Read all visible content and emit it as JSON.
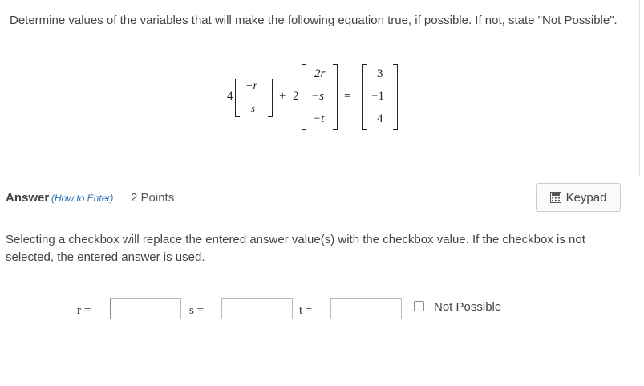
{
  "question": {
    "prompt": "Determine values of the variables that will make the following equation true, if possible. If not, state \"Not Possible\".",
    "equation": {
      "coef1": "4",
      "m1": [
        "−r",
        "s"
      ],
      "plus": "+",
      "coef2": "2",
      "m2": [
        "2r",
        "−s",
        "−t"
      ],
      "equals": "=",
      "m3": [
        "3",
        "−1",
        "4"
      ]
    }
  },
  "answer": {
    "label": "Answer",
    "how_to_enter": "(How to Enter)",
    "points": "2 Points",
    "keypad_label": "Keypad",
    "info": "Selecting a checkbox will replace the entered answer value(s) with the checkbox value. If the checkbox is not selected, the entered answer is used.",
    "fields": [
      {
        "label": "r =",
        "value": ""
      },
      {
        "label": "s =",
        "value": ""
      },
      {
        "label": "t =",
        "value": ""
      }
    ],
    "checkbox_label": "Not Possible",
    "checkbox_checked": false
  }
}
